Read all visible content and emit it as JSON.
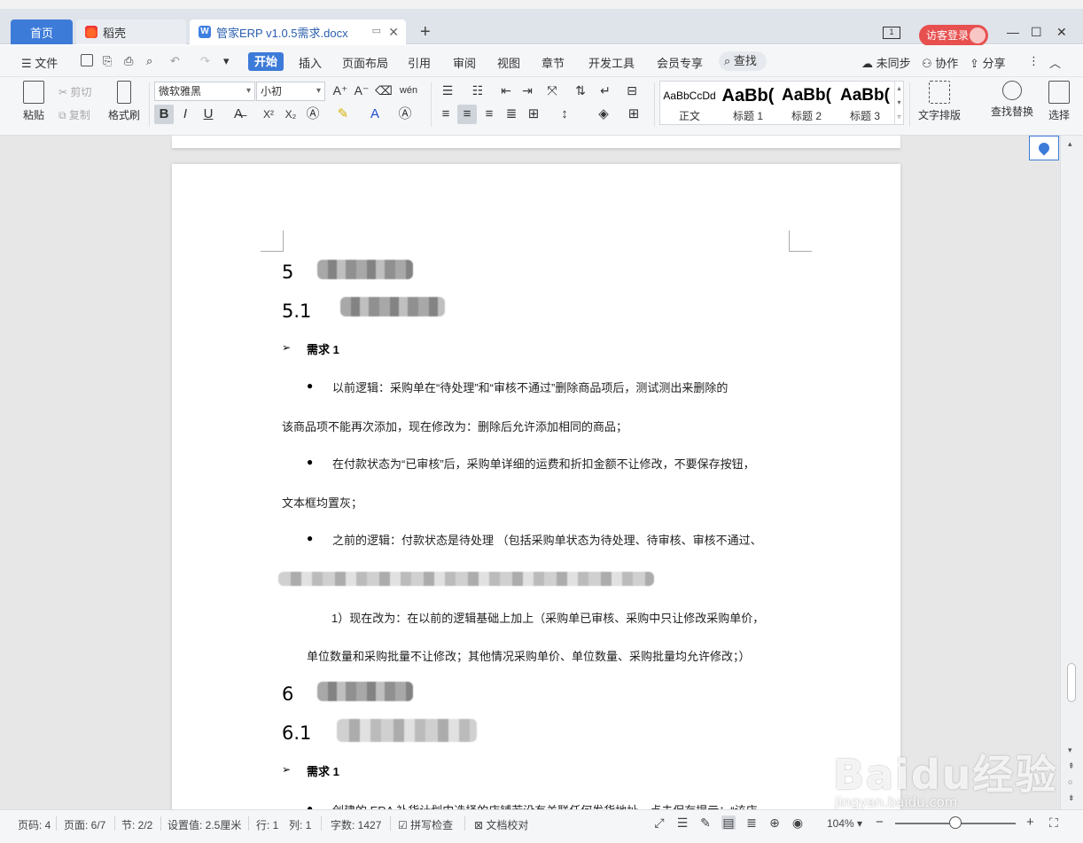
{
  "tabs": {
    "home": "首页",
    "daoke": "稻壳",
    "doc": "管家ERP v1.0.5需求.docx"
  },
  "title_bar": {
    "visitor_login": "访客登录"
  },
  "menu": {
    "file": "文件",
    "start": "开始",
    "insert": "插入",
    "page_layout": "页面布局",
    "references": "引用",
    "review": "审阅",
    "view": "视图",
    "chapter": "章节",
    "dev_tools": "开发工具",
    "member": "会员专享",
    "find": "查找",
    "unsynced": "未同步",
    "collab": "协作",
    "share": "分享"
  },
  "ribbon": {
    "paste": "粘贴",
    "cut": "剪切",
    "copy": "复制",
    "format_painter": "格式刷",
    "font_name": "微软雅黑",
    "font_size": "小初",
    "styles": [
      {
        "sample": "AaBbCcDd",
        "name": "正文"
      },
      {
        "sample": "AaBb(",
        "name": "标题 1"
      },
      {
        "sample": "AaBb(",
        "name": "标题 2"
      },
      {
        "sample": "AaBb(",
        "name": "标题 3"
      }
    ],
    "text_layout": "文字排版",
    "find_replace": "查找替换",
    "select": "选择"
  },
  "document": {
    "h5": "5",
    "h5_1": "5.1",
    "req1_title": "需求 1",
    "b1_line1": "以前逻辑：采购单在“待处理”和“审核不通过”删除商品项后，测试测出来删除的",
    "b1_line2": "该商品项不能再次添加，现在修改为：删除后允许添加相同的商品；",
    "b2_line1": "在付款状态为“已审核”后，采购单详细的运费和折扣金额不让修改，不要保存按钮，",
    "b2_line2": "文本框均置灰；",
    "b3_line1": "之前的逻辑：付款状态是待处理 （包括采购单状态为待处理、待审核、审核不通过、",
    "sub_line1": "1）现在改为：在以前的逻辑基础上加上（采购单已审核、采购中只让修改采购单价，",
    "sub_line2": "单位数量和采购批量不让修改；其他情况采购单价、单位数量、采购批量均允许修改；）",
    "h6": "6",
    "h6_1": "6.1",
    "req1b_title": "需求 1",
    "b4_line1_partial": "创建的 ERA 补货计划中选择的店铺若没有关联任何发货地址，点击保存提示：“该店"
  },
  "status": {
    "page_code": "页码: 4",
    "page": "页面: 6/7",
    "section": "节: 2/2",
    "setting": "设置值: 2.5厘米",
    "row": "行: 1",
    "col": "列: 1",
    "word_count": "字数: 1427",
    "spell_check": "拼写检查",
    "doc_proof": "文档校对",
    "zoom": "104%"
  },
  "watermark": {
    "brand": "Baidu经验",
    "url": "jingyan.baidu.com"
  },
  "colors": {
    "accent": "#3d7bd9",
    "visitor": "#e7504f"
  }
}
